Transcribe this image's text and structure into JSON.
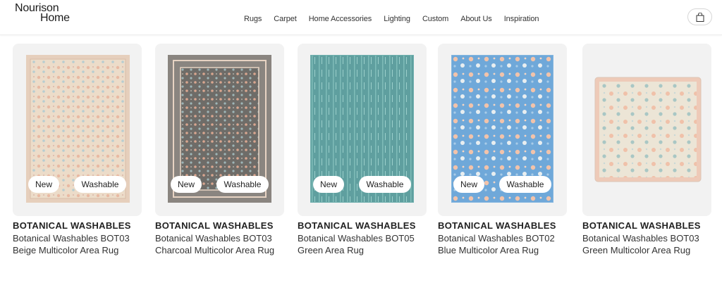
{
  "header": {
    "logo_line1": "Nourison",
    "logo_line2": "Home",
    "nav": [
      "Rugs",
      "Carpet",
      "Home Accessories",
      "Lighting",
      "Custom",
      "About Us",
      "Inspiration"
    ],
    "cart_icon": "shopping-bag-icon"
  },
  "badges": {
    "new": "New",
    "washable": "Washable"
  },
  "products": [
    {
      "brand": "BOTANICAL WASHABLES",
      "title": "Botanical Washables BOT03 Beige Multicolor Area Rug",
      "badges": [
        "New",
        "Washable"
      ],
      "colors": {
        "field": "#ead9c6",
        "border": "#e3cab7",
        "accent": "#a8c2c7"
      }
    },
    {
      "brand": "BOTANICAL WASHABLES",
      "title": "Botanical Washables BOT03 Charcoal Multicolor Area Rug",
      "badges": [
        "New",
        "Washable"
      ],
      "colors": {
        "field": "#6f6e6a",
        "border": "#8a8580",
        "accent": "#e1b49a"
      }
    },
    {
      "brand": "BOTANICAL WASHABLES",
      "title": "Botanical Washables BOT05 Green Area Rug",
      "badges": [
        "New",
        "Washable"
      ],
      "colors": {
        "field": "#5fa3a2",
        "border": "#6fb0ae",
        "accent": "#9fcfcc"
      }
    },
    {
      "brand": "BOTANICAL WASHABLES",
      "title": "Botanical Washables BOT02 Blue Multicolor Area Rug",
      "badges": [
        "New",
        "Washable"
      ],
      "colors": {
        "field": "#6ea7d8",
        "border": "#84b6df",
        "accent": "#f3c2a8"
      }
    },
    {
      "brand": "BOTANICAL WASHABLES",
      "title": "Botanical Washables BOT03 Green Multicolor Area Rug",
      "badges": [],
      "colors": {
        "field": "#e8e2d3",
        "border": "#efbfa8",
        "accent": "#9cc0bd"
      }
    }
  ]
}
